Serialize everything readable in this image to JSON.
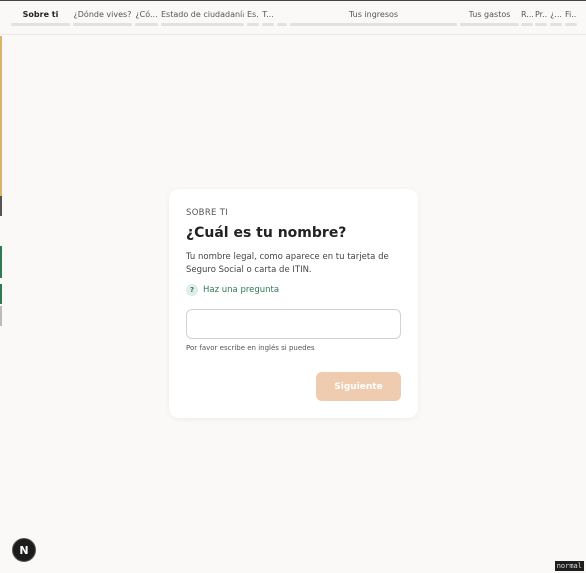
{
  "nav": {
    "steps": [
      {
        "label": "Sobre ti",
        "active": true
      },
      {
        "label": "¿Dónde vives?",
        "active": false
      },
      {
        "label": "¿Có...",
        "active": false
      },
      {
        "label": "Estado de ciudadanía",
        "active": false
      },
      {
        "label": "Es...",
        "active": false
      },
      {
        "label": "T...",
        "active": false
      },
      {
        "label": "",
        "active": false
      },
      {
        "label": "Tus ingresos",
        "active": false
      },
      {
        "label": "Tus gastos",
        "active": false
      },
      {
        "label": "R...",
        "active": false
      },
      {
        "label": "Pr...",
        "active": false
      },
      {
        "label": "¿...",
        "active": false
      },
      {
        "label": "Fi...",
        "active": false
      }
    ]
  },
  "card": {
    "eyebrow": "SOBRE TI",
    "title": "¿Cuál es tu nombre?",
    "description": "Tu nombre legal, como aparece en tu tarjeta de Seguro Social o carta de ITIN.",
    "ask_label": "Haz una pregunta",
    "ask_icon": "?",
    "name_value": "",
    "name_placeholder": "",
    "hint": "Por favor escribe en inglés si puedes",
    "next_label": "Siguiente"
  },
  "fab": {
    "label": "N"
  },
  "mode": {
    "label": "normal"
  },
  "colors": {
    "accent_green": "#2f7a55",
    "button_disabled": "#efccb0",
    "background": "#faf9f7"
  }
}
